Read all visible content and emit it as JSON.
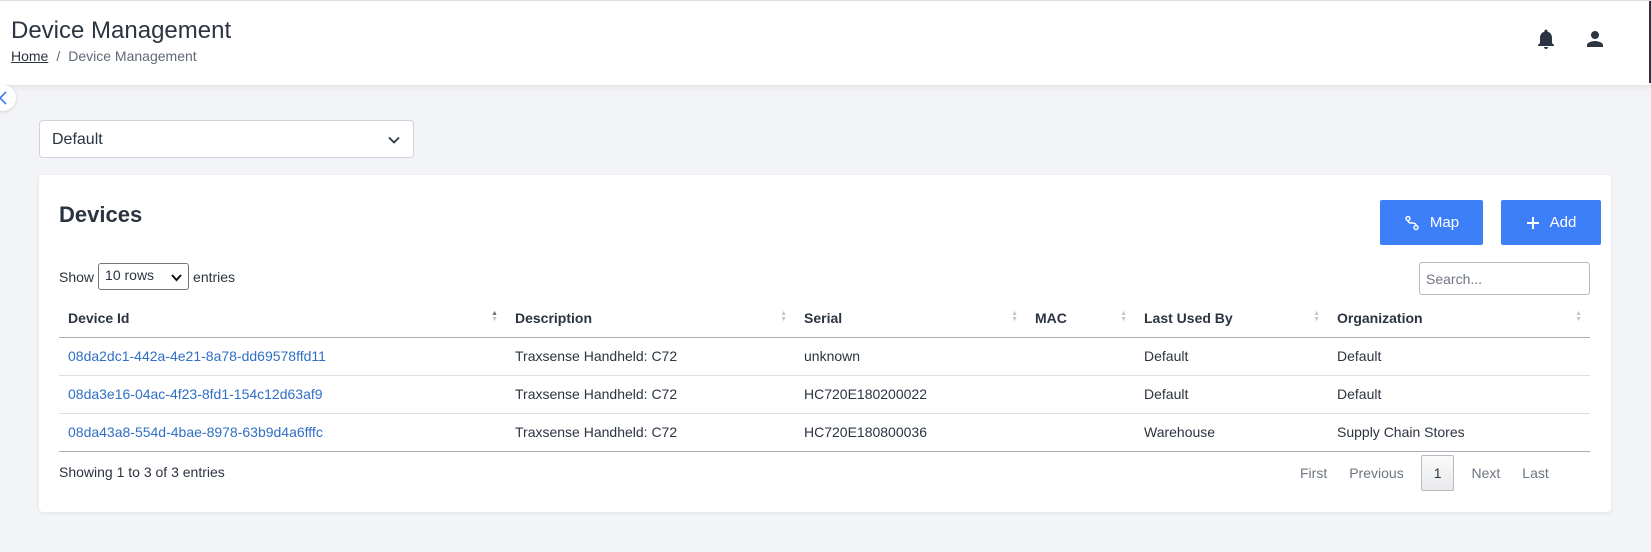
{
  "header": {
    "title": "Device Management",
    "breadcrumb": {
      "home": "Home",
      "separator": "/",
      "current": "Device Management"
    },
    "icons": [
      "bell-icon",
      "user-icon"
    ]
  },
  "org_select": {
    "value": "Default"
  },
  "devices": {
    "title": "Devices",
    "map_label": "Map",
    "add_label": "Add",
    "show_label": "Show",
    "rows_value": "10 rows",
    "entries_label": "entries",
    "search_placeholder": "Search...",
    "columns": [
      "Device Id",
      "Description",
      "Serial",
      "MAC",
      "Last Used By",
      "Organization"
    ],
    "rows": [
      {
        "device_id": "08da2dc1-442a-4e21-8a78-dd69578ffd11",
        "description": "Traxsense Handheld: C72",
        "serial": "unknown",
        "mac": "",
        "last_used_by": "Default",
        "organization": "Default"
      },
      {
        "device_id": "08da3e16-04ac-4f23-8fd1-154c12d63af9",
        "description": "Traxsense Handheld: C72",
        "serial": "HC720E180200022",
        "mac": "",
        "last_used_by": "Default",
        "organization": "Default"
      },
      {
        "device_id": "08da43a8-554d-4bae-8978-63b9d4a6fffc",
        "description": "Traxsense Handheld: C72",
        "serial": "HC720E180800036",
        "mac": "",
        "last_used_by": "Warehouse",
        "organization": "Supply Chain Stores"
      }
    ],
    "info": "Showing 1 to 3 of 3 entries",
    "pager": {
      "first": "First",
      "previous": "Previous",
      "current": "1",
      "next": "Next",
      "last": "Last"
    }
  },
  "colors": {
    "primary": "#3d7ff9",
    "link": "#2f6fc6",
    "background": "#f3f4f7"
  }
}
